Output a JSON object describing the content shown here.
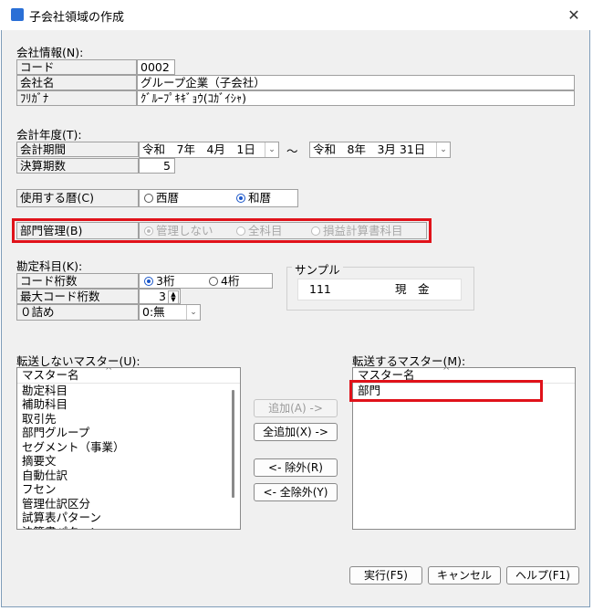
{
  "window": {
    "title": "子会社領域の作成",
    "close_glyph": "✕"
  },
  "company": {
    "section_label": "会社情報(N):",
    "code_label": "コード",
    "code_value": "0002",
    "name_label": "会社名",
    "name_value": "グループ企業（子会社）",
    "kana_label": "ﾌﾘｶﾞﾅ",
    "kana_value": "ｸﾞﾙｰﾌﾟｷｷﾞｮｳ(ｺｶﾞｲｼｬ)"
  },
  "fiscal": {
    "section_label": "会計年度(T):",
    "period_label": "会計期間",
    "start_date": "令和　7年　4月　1日",
    "tilde": "～",
    "end_date": "令和　8年　3月 31日",
    "count_label": "決算期数",
    "count_value": "5"
  },
  "calendar": {
    "label": "使用する暦(C)",
    "options": [
      "西暦",
      "和暦"
    ],
    "selected": "和暦"
  },
  "department": {
    "label": "部門管理(B)",
    "options": [
      "管理しない",
      "全科目",
      "損益計算書科目"
    ],
    "selected": "管理しない"
  },
  "account": {
    "section_label": "勘定科目(K):",
    "digits_label": "コード桁数",
    "digits_options": [
      "3桁",
      "4桁"
    ],
    "digits_selected": "3桁",
    "max_label": "最大コード桁数",
    "max_value": "3",
    "zero_label": "０詰め",
    "zero_value": "0:無"
  },
  "sample": {
    "label": "サンプル",
    "code": "111",
    "name": "現　金"
  },
  "lists": {
    "left_label": "転送しないマスター(U):",
    "left_header": "マスター名",
    "left_items": [
      "勘定科目",
      "補助科目",
      "取引先",
      "部門グループ",
      "セグメント（事業）",
      "摘要文",
      "自動仕訳",
      "フセン",
      "管理仕訳区分",
      "試算表パターン",
      "決算書パターン"
    ],
    "right_label": "転送するマスター(M):",
    "right_header": "マスター名",
    "right_items": [
      "部門"
    ],
    "sort_glyph": "^"
  },
  "transfer_buttons": {
    "add": "追加(A) ->",
    "add_all": "全追加(X) ->",
    "remove": "<- 除外(R)",
    "remove_all": "<- 全除外(Y)"
  },
  "footer": {
    "run": "実行(F5)",
    "cancel": "キャンセル",
    "help": "ヘルプ(F1)"
  },
  "colors": {
    "highlight": "#e0121a",
    "accent": "#1a56c8"
  }
}
